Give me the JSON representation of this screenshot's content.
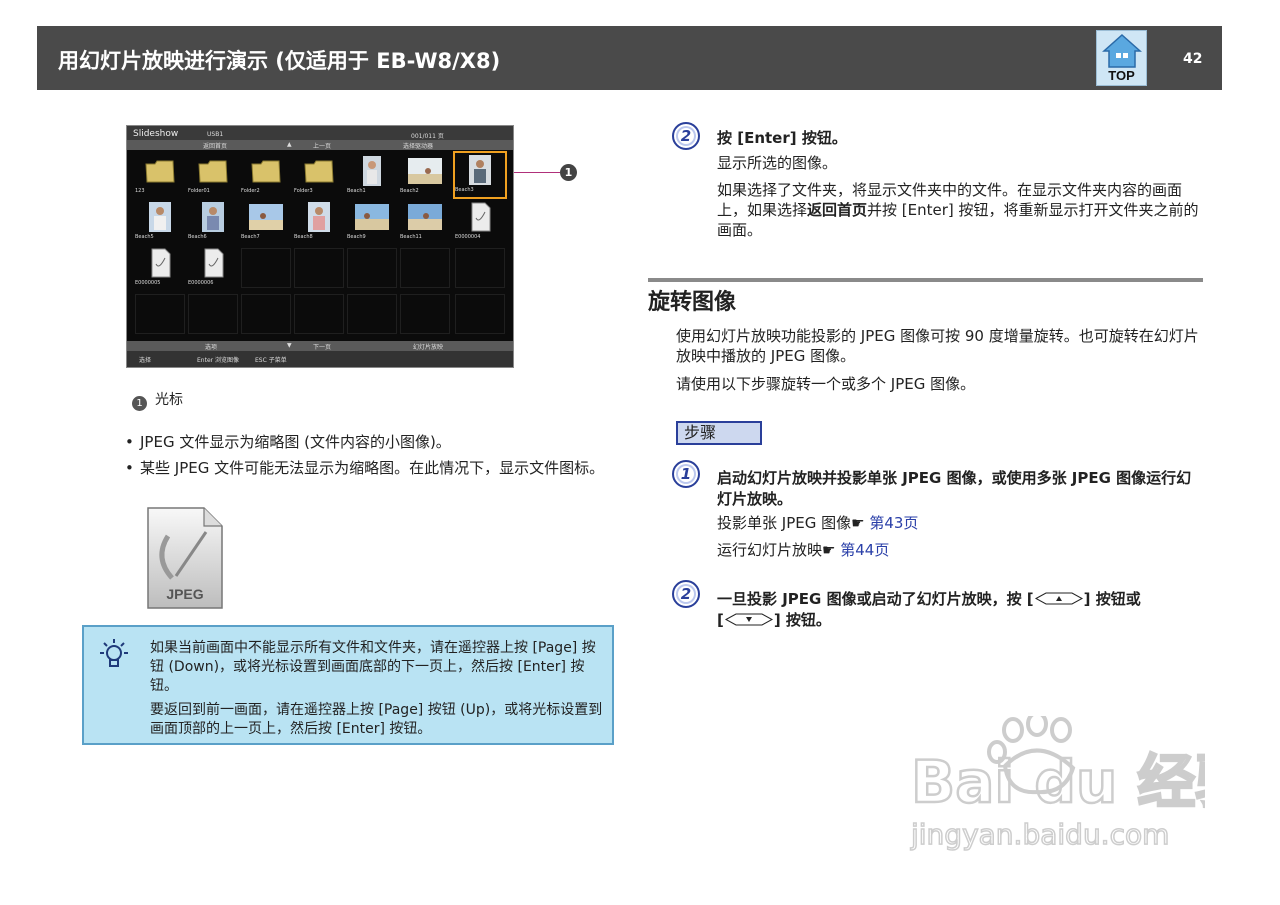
{
  "header": {
    "title": "用幻灯片放映进行演示 (仅适用于 EB-W8/X8)",
    "top_label": "TOP",
    "page_number": "42"
  },
  "screenshot": {
    "title": "Slideshow",
    "usb": "USB1",
    "count": "001/011 页",
    "nav_labels": [
      "返回首页",
      "上一页",
      "选择驱动器"
    ],
    "row1_caps": [
      "123",
      "Folder01",
      "Folder2",
      "Folder3",
      "Beach1",
      "Beach2",
      "Beach3"
    ],
    "row2_caps": [
      "Beach5",
      "Beach6",
      "Beach7",
      "Beach8",
      "Beach9",
      "Beach11",
      "E0000004"
    ],
    "row3_caps": [
      "E0000005",
      "E0000006"
    ],
    "bottom_labels": [
      "选项",
      "下一页",
      "幻灯片放映"
    ],
    "footer_labels": [
      "选择",
      "Enter 浏览图像",
      "ESC 子菜单"
    ]
  },
  "callout_number": "❶",
  "legend": {
    "number": "1",
    "label": "光标"
  },
  "bullets": [
    "JPEG 文件显示为缩略图 (文件内容的小图像)。",
    "某些 JPEG 文件可能无法显示为缩略图。在此情况下，显示文件图标。"
  ],
  "jpeg_icon_label": "JPEG",
  "tip": {
    "p1": "如果当前画面中不能显示所有文件和文件夹，请在遥控器上按 [Page] 按钮 (Down)，或将光标设置到画面底部的下一页上，然后按 [Enter] 按钮。",
    "p2": "要返回到前一画面，请在遥控器上按 [Page] 按钮 (Up)，或将光标设置到画面顶部的上一页上，然后按 [Enter] 按钮。"
  },
  "step2a": {
    "number": "2",
    "heading": "按 [Enter] 按钮。",
    "line1": "显示所选的图像。",
    "line2_a": "如果选择了文件夹，将显示文件夹中的文件。在显示文件夹内容的画面上，如果选择",
    "line2_bold": "返回首页",
    "line2_b": "并按 [Enter] 按钮，将重新显示打开文件夹之前的画面。"
  },
  "section": {
    "title": "旋转图像",
    "intro": "使用幻灯片放映功能投影的 JPEG 图像可按 90 度增量旋转。也可旋转在幻灯片放映中播放的 JPEG 图像。",
    "intro2": "请使用以下步骤旋转一个或多个 JPEG 图像。",
    "steps_label": "步骤"
  },
  "step1": {
    "number": "1",
    "heading": "启动幻灯片放映并投影单张 JPEG 图像，或使用多张 JPEG 图像运行幻灯片放映。",
    "ref1_text": "投影单张 JPEG 图像",
    "ref1_link": "第43页",
    "ref2_text": "运行幻灯片放映",
    "ref2_link": "第44页",
    "pointer": "☛"
  },
  "step2b": {
    "number": "2",
    "heading_a": "一旦投影 JPEG 图像或启动了幻灯片放映，按 [",
    "heading_b": "] 按钮或",
    "heading_c": "[",
    "heading_d": "] 按钮。"
  },
  "watermark": {
    "brand": "Bai du 经验",
    "url": "jingyan.baidu.com"
  },
  "colors": {
    "header_bg": "#4a4a4a",
    "step_blue": "#2a3f9a",
    "tip_bg": "#b9e3f3",
    "selection": "#f0a020"
  }
}
